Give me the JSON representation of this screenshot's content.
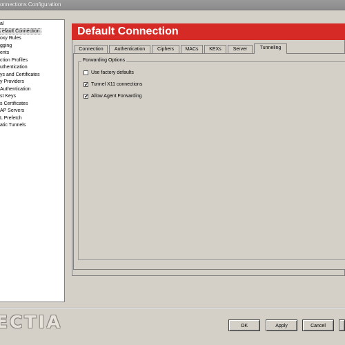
{
  "window": {
    "title": "onnections Configuration"
  },
  "sidebar": {
    "items": [
      {
        "label": "al",
        "selected": false
      },
      {
        "label": "efault Connection",
        "selected": true
      },
      {
        "label": "oxy Rules",
        "selected": false
      },
      {
        "label": "gging",
        "selected": false
      },
      {
        "label": "ents",
        "selected": false
      },
      {
        "label": "ction Profiles",
        "selected": false
      },
      {
        "label": "uthentication",
        "selected": false
      },
      {
        "label": "ys and Certificates",
        "selected": false
      },
      {
        "label": "y Providers",
        "selected": false
      },
      {
        "label": " Authentication",
        "selected": false
      },
      {
        "label": "st Keys",
        "selected": false
      },
      {
        "label": "s Certificates",
        "selected": false
      },
      {
        "label": "AP Servers",
        "selected": false
      },
      {
        "label": "L Prefetch",
        "selected": false
      },
      {
        "label": "atic Tunnels",
        "selected": false
      }
    ]
  },
  "main": {
    "title": "Default Connection",
    "banner_color": "#d52a26",
    "tabs": [
      {
        "label": "Connection",
        "active": false
      },
      {
        "label": "Authentication",
        "active": false
      },
      {
        "label": "Ciphers",
        "active": false
      },
      {
        "label": "MACs",
        "active": false
      },
      {
        "label": "KEXs",
        "active": false
      },
      {
        "label": "Server",
        "active": false
      },
      {
        "label": "Tunneling",
        "active": true
      }
    ],
    "group_label": "Forwarding Options",
    "options": [
      {
        "label": "Use factory defaults",
        "checked": false
      },
      {
        "label": "Tunnel X11 connections",
        "checked": true
      },
      {
        "label": "Allow Agent Forwarding",
        "checked": true
      }
    ]
  },
  "footer": {
    "logo_text": "ECTIA",
    "buttons": {
      "ok": "OK",
      "apply": "Apply",
      "cancel": "Cancel"
    }
  }
}
